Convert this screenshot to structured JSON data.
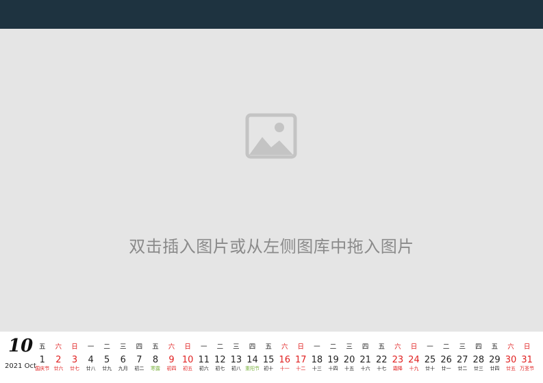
{
  "placeholder": {
    "text": "双击插入图片或从左侧图库中拖入图片",
    "icon": "image-placeholder-icon"
  },
  "calendar": {
    "month_number": "10",
    "year_month": "2021 Oct",
    "colors": {
      "weekend": "#e02020",
      "solar_term": "#7cb342",
      "topbar": "#1e3340"
    },
    "days": [
      {
        "weekday": "五",
        "day": "1",
        "lunar": "国庆节",
        "weekend": false,
        "lunar_style": "red"
      },
      {
        "weekday": "六",
        "day": "2",
        "lunar": "廿六",
        "weekend": true,
        "lunar_style": ""
      },
      {
        "weekday": "日",
        "day": "3",
        "lunar": "廿七",
        "weekend": true,
        "lunar_style": ""
      },
      {
        "weekday": "一",
        "day": "4",
        "lunar": "廿八",
        "weekend": false,
        "lunar_style": ""
      },
      {
        "weekday": "二",
        "day": "5",
        "lunar": "廿九",
        "weekend": false,
        "lunar_style": ""
      },
      {
        "weekday": "三",
        "day": "6",
        "lunar": "九月",
        "weekend": false,
        "lunar_style": ""
      },
      {
        "weekday": "四",
        "day": "7",
        "lunar": "初二",
        "weekend": false,
        "lunar_style": ""
      },
      {
        "weekday": "五",
        "day": "8",
        "lunar": "寒露",
        "weekend": false,
        "lunar_style": "green"
      },
      {
        "weekday": "六",
        "day": "9",
        "lunar": "初四",
        "weekend": true,
        "lunar_style": ""
      },
      {
        "weekday": "日",
        "day": "10",
        "lunar": "初五",
        "weekend": true,
        "lunar_style": ""
      },
      {
        "weekday": "一",
        "day": "11",
        "lunar": "初六",
        "weekend": false,
        "lunar_style": ""
      },
      {
        "weekday": "二",
        "day": "12",
        "lunar": "初七",
        "weekend": false,
        "lunar_style": ""
      },
      {
        "weekday": "三",
        "day": "13",
        "lunar": "初八",
        "weekend": false,
        "lunar_style": ""
      },
      {
        "weekday": "四",
        "day": "14",
        "lunar": "重阳节",
        "weekend": false,
        "lunar_style": "green"
      },
      {
        "weekday": "五",
        "day": "15",
        "lunar": "初十",
        "weekend": false,
        "lunar_style": ""
      },
      {
        "weekday": "六",
        "day": "16",
        "lunar": "十一",
        "weekend": true,
        "lunar_style": ""
      },
      {
        "weekday": "日",
        "day": "17",
        "lunar": "十二",
        "weekend": true,
        "lunar_style": ""
      },
      {
        "weekday": "一",
        "day": "18",
        "lunar": "十三",
        "weekend": false,
        "lunar_style": ""
      },
      {
        "weekday": "二",
        "day": "19",
        "lunar": "十四",
        "weekend": false,
        "lunar_style": ""
      },
      {
        "weekday": "三",
        "day": "20",
        "lunar": "十五",
        "weekend": false,
        "lunar_style": ""
      },
      {
        "weekday": "四",
        "day": "21",
        "lunar": "十六",
        "weekend": false,
        "lunar_style": ""
      },
      {
        "weekday": "五",
        "day": "22",
        "lunar": "十七",
        "weekend": false,
        "lunar_style": ""
      },
      {
        "weekday": "六",
        "day": "23",
        "lunar": "霜降",
        "weekend": true,
        "lunar_style": ""
      },
      {
        "weekday": "日",
        "day": "24",
        "lunar": "十九",
        "weekend": true,
        "lunar_style": ""
      },
      {
        "weekday": "一",
        "day": "25",
        "lunar": "廿十",
        "weekend": false,
        "lunar_style": ""
      },
      {
        "weekday": "二",
        "day": "26",
        "lunar": "廿一",
        "weekend": false,
        "lunar_style": ""
      },
      {
        "weekday": "三",
        "day": "27",
        "lunar": "廿二",
        "weekend": false,
        "lunar_style": ""
      },
      {
        "weekday": "四",
        "day": "28",
        "lunar": "廿三",
        "weekend": false,
        "lunar_style": ""
      },
      {
        "weekday": "五",
        "day": "29",
        "lunar": "廿四",
        "weekend": false,
        "lunar_style": ""
      },
      {
        "weekday": "六",
        "day": "30",
        "lunar": "廿五",
        "weekend": true,
        "lunar_style": ""
      },
      {
        "weekday": "日",
        "day": "31",
        "lunar": "万圣节",
        "weekend": true,
        "lunar_style": ""
      }
    ]
  }
}
